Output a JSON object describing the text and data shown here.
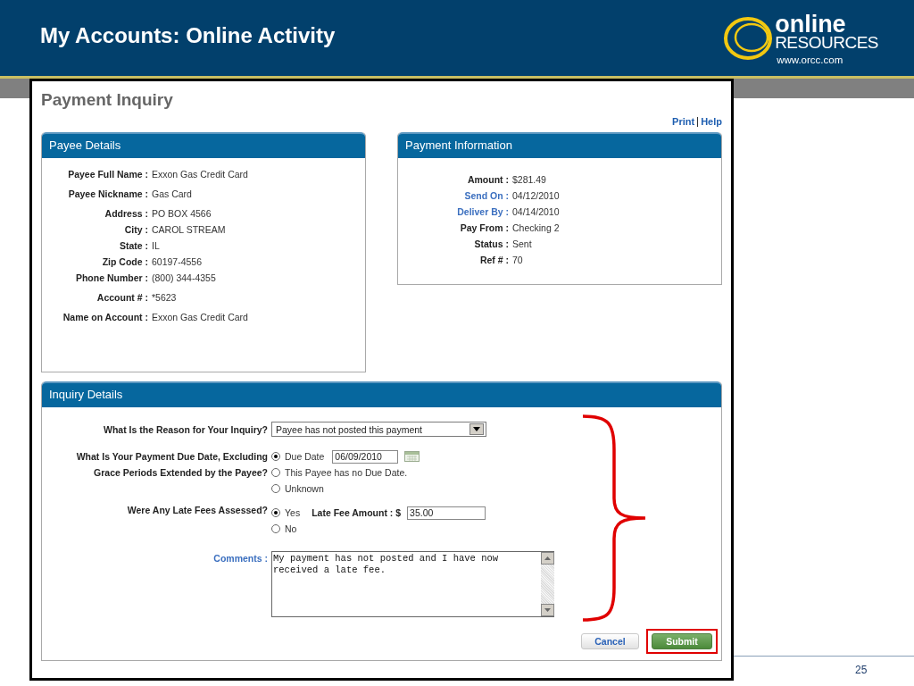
{
  "slide": {
    "title": "My Accounts: Online Activity",
    "logo": {
      "word": "online",
      "subword": "RESOURCES",
      "url": "www.orcc.com"
    },
    "page_number": "25"
  },
  "page": {
    "title": "Payment Inquiry",
    "links": [
      "Print",
      "Help"
    ]
  },
  "payee_details": {
    "title": "Payee Details",
    "groups": [
      [
        {
          "label": "Payee Full Name :",
          "value": "Exxon Gas Credit Card"
        }
      ],
      [
        {
          "label": "Payee Nickname :",
          "value": "Gas Card"
        }
      ],
      [
        {
          "label": "Address :",
          "value": "PO BOX 4566"
        },
        {
          "label": "City :",
          "value": "CAROL STREAM"
        },
        {
          "label": "State :",
          "value": "IL"
        },
        {
          "label": "Zip Code :",
          "value": "60197-4556"
        },
        {
          "label": "Phone Number :",
          "value": "(800) 344-4355"
        }
      ],
      [
        {
          "label": "Account # :",
          "value": "*5623"
        }
      ],
      [
        {
          "label": "Name on Account :",
          "value": "Exxon Gas Credit Card"
        }
      ]
    ]
  },
  "payment_information": {
    "title": "Payment Information",
    "rows": [
      {
        "label": "Amount :",
        "value": "$281.49",
        "link": false
      },
      {
        "label": "Send On :",
        "value": "04/12/2010",
        "link": true
      },
      {
        "label": "Deliver By :",
        "value": "04/14/2010",
        "link": true
      },
      {
        "label": "Pay From :",
        "value": "Checking 2",
        "link": false
      },
      {
        "label": "Status :",
        "value": "Sent",
        "link": false
      },
      {
        "label": "Ref # :",
        "value": "70",
        "link": false
      }
    ]
  },
  "inquiry_details": {
    "title": "Inquiry Details",
    "reason": {
      "label": "What Is the Reason for Your Inquiry?",
      "value": "Payee has not posted this payment"
    },
    "due_date": {
      "label_lines": [
        "What Is Your Payment Due Date, Excluding",
        "Grace Periods Extended by the Payee?"
      ],
      "options": [
        {
          "label": "Due Date",
          "selected": true,
          "date": "06/09/2010"
        },
        {
          "label": "This Payee has no Due Date.",
          "selected": false
        },
        {
          "label": "Unknown",
          "selected": false
        }
      ]
    },
    "late_fees": {
      "label": "Were Any Late Fees Assessed?",
      "options": [
        {
          "label": "Yes",
          "selected": true
        },
        {
          "label": "No",
          "selected": false
        }
      ],
      "amount_label": "Late Fee Amount : $",
      "amount": "35.00"
    },
    "comments": {
      "label": "Comments :",
      "value": "My payment has not posted and I have now received a late fee."
    },
    "buttons": [
      {
        "label": "Cancel",
        "kind": "secondary",
        "highlighted": false
      },
      {
        "label": "Submit",
        "kind": "primary",
        "highlighted": true
      }
    ]
  }
}
